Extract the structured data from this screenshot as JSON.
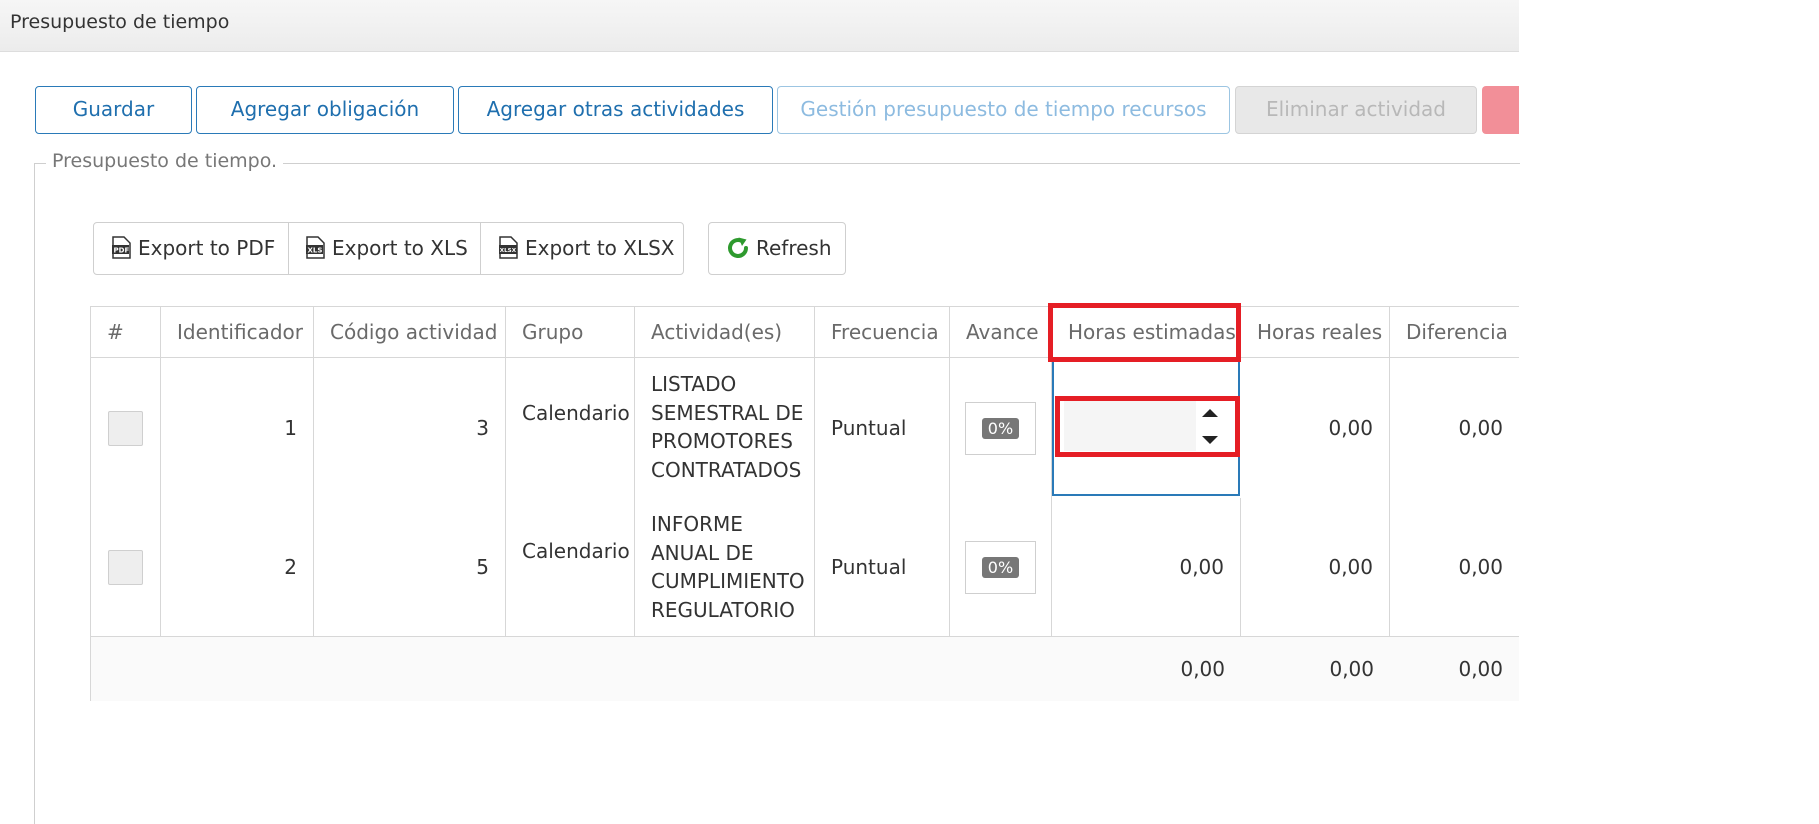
{
  "window": {
    "title": "Presupuesto de tiempo"
  },
  "toolbar": {
    "guardar": "Guardar",
    "agregar_obligacion": "Agregar obligación",
    "agregar_otras": "Agregar otras actividades",
    "gestion_recursos": "Gestión presupuesto de tiempo recursos",
    "eliminar_actividad": "Eliminar actividad"
  },
  "section": {
    "legend": "Presupuesto de tiempo."
  },
  "export": {
    "pdf": "Export to PDF",
    "xls": "Export to XLS",
    "xlsx": "Export to XLSX",
    "refresh": "Refresh",
    "pdf_icon_text": "PDF",
    "xls_icon_text": "XLS",
    "xlsx_icon_text": "XLSX"
  },
  "grid": {
    "headers": [
      "#",
      "Identificador",
      "Código actividad",
      "Grupo",
      "Actividad(es)",
      "Frecuencia",
      "Avance",
      "Horas estimadas",
      "Horas reales",
      "Diferencia"
    ],
    "rows": [
      {
        "identificador": "1",
        "codigo": "3",
        "grupo": "Calendario",
        "actividad": [
          "LISTADO",
          "SEMESTRAL DE",
          "PROMOTORES",
          "CONTRATADOS"
        ],
        "frecuencia": "Puntual",
        "avance": "0%",
        "horas_estimadas": "",
        "horas_reales": "0,00",
        "diferencia": "0,00"
      },
      {
        "identificador": "2",
        "codigo": "5",
        "grupo": "Calendario",
        "actividad": [
          "INFORME",
          "ANUAL DE",
          "CUMPLIMIENTO",
          "REGULATORIO"
        ],
        "frecuencia": "Puntual",
        "avance": "0%",
        "horas_estimadas": "0,00",
        "horas_reales": "0,00",
        "diferencia": "0,00"
      }
    ],
    "totals": {
      "horas_estimadas": "0,00",
      "horas_reales": "0,00",
      "diferencia": "0,00"
    }
  },
  "colors": {
    "accent": "#2a7ab8",
    "highlight": "#e51e25",
    "danger_button": "#f28f98"
  },
  "icons": [
    "pdf-file-icon",
    "xls-file-icon",
    "xlsx-file-icon",
    "refresh-icon",
    "spinner-up-icon",
    "spinner-down-icon"
  ]
}
